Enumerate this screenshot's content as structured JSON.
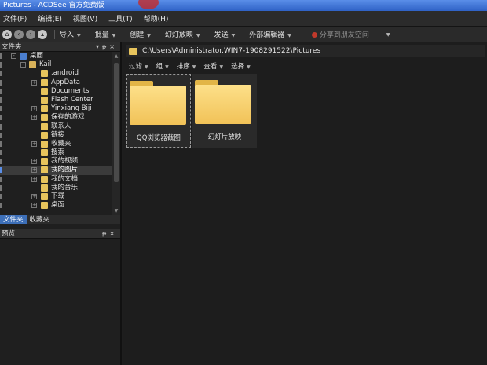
{
  "window": {
    "title": "Pictures - ACDSee 官方免费版"
  },
  "menu": [
    "文件(F)",
    "编辑(E)",
    "视图(V)",
    "工具(T)",
    "帮助(H)"
  ],
  "toolbar": {
    "items": [
      "导入",
      "批量",
      "创建",
      "幻灯放映",
      "发送",
      "外部编辑器"
    ],
    "share": "分享到朋友空间"
  },
  "folders_panel": {
    "title": "文件夹",
    "tree": [
      {
        "label": "桌面",
        "level": 1
      },
      {
        "label": "Kail",
        "level": 2
      },
      {
        "label": ".android",
        "level": 3
      },
      {
        "label": "AppData",
        "level": 3
      },
      {
        "label": "Documents",
        "level": 3
      },
      {
        "label": "Flash Center",
        "level": 3
      },
      {
        "label": "Yinxiang Biji",
        "level": 3
      },
      {
        "label": "保存的游戏",
        "level": 3
      },
      {
        "label": "联系人",
        "level": 3
      },
      {
        "label": "链接",
        "level": 3
      },
      {
        "label": "收藏夹",
        "level": 3
      },
      {
        "label": "搜索",
        "level": 3
      },
      {
        "label": "我的视频",
        "level": 3
      },
      {
        "label": "我的图片",
        "level": 3,
        "selected": true
      },
      {
        "label": "我的文档",
        "level": 3
      },
      {
        "label": "我的音乐",
        "level": 3
      },
      {
        "label": "下载",
        "level": 3
      },
      {
        "label": "桌面",
        "level": 3
      }
    ],
    "tabs": [
      "文件夹",
      "收藏夹"
    ]
  },
  "preview_panel": {
    "title": "预览"
  },
  "address": {
    "path": "C:\\Users\\Administrator.WIN7-1908291522\\Pictures"
  },
  "filterbar": [
    "过滤",
    "组",
    "排序",
    "查看",
    "选择"
  ],
  "files": [
    {
      "name": "QQ浏览器截图",
      "selected": true
    },
    {
      "name": "幻灯片放映",
      "selected": false
    }
  ]
}
